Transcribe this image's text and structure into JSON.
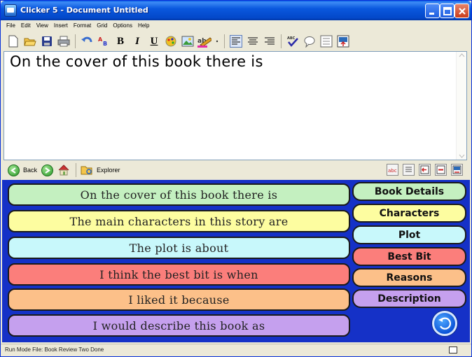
{
  "window": {
    "title": "Clicker 5 - Document Untitled"
  },
  "menu": [
    "File",
    "Edit",
    "View",
    "Insert",
    "Format",
    "Grid",
    "Options",
    "Help"
  ],
  "toolbar": {
    "bold_label": "B",
    "italic_label": "I",
    "underline_label": "U"
  },
  "document": {
    "text": "On the cover of this book there is"
  },
  "nav": {
    "back_label": "Back",
    "explorer_label": "Explorer"
  },
  "phrases": [
    {
      "text": "On the cover of this book there is",
      "color": "#c4f0c0"
    },
    {
      "text": "The main characters in this story are",
      "color": "#fdfda0"
    },
    {
      "text": "The plot is about",
      "color": "#c8f8fb"
    },
    {
      "text": "I think the best bit is when",
      "color": "#fb7e7b"
    },
    {
      "text": "I liked it because",
      "color": "#fcc089"
    },
    {
      "text": "I would describe this book as",
      "color": "#c5a0ee"
    }
  ],
  "tabs": [
    {
      "label": "Book Details",
      "color": "#c4f0c0"
    },
    {
      "label": "Characters",
      "color": "#fdfda0"
    },
    {
      "label": "Plot",
      "color": "#c8f8fb"
    },
    {
      "label": "Best Bit",
      "color": "#fb7e7b"
    },
    {
      "label": "Reasons",
      "color": "#fcc089"
    },
    {
      "label": "Description",
      "color": "#c5a0ee"
    }
  ],
  "status": {
    "text": "Run Mode  File: Book Review Two  Done"
  }
}
